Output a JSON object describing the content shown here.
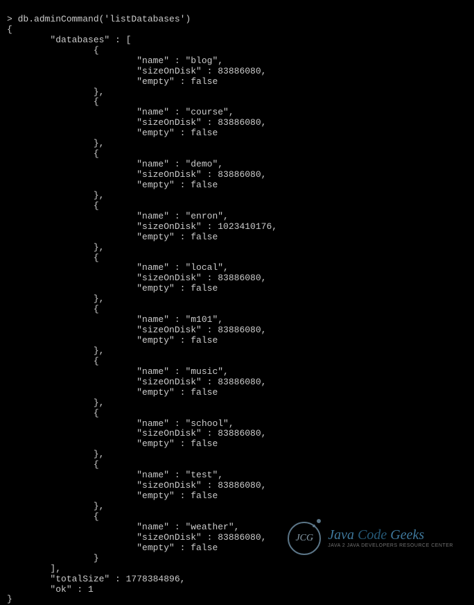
{
  "prompt": "> ",
  "command": "db.adminCommand('listDatabases')",
  "open_brace": "{",
  "databases_key": "        \"databases\" : [",
  "item_open": "                {",
  "item_close": "                },",
  "item_close_last": "                }",
  "array_close": "        ],",
  "close_brace": "}",
  "databases": [
    {
      "name": "blog",
      "sizeOnDisk": 83886080,
      "empty": false
    },
    {
      "name": "course",
      "sizeOnDisk": 83886080,
      "empty": false
    },
    {
      "name": "demo",
      "sizeOnDisk": 83886080,
      "empty": false
    },
    {
      "name": "enron",
      "sizeOnDisk": 1023410176,
      "empty": false
    },
    {
      "name": "local",
      "sizeOnDisk": 83886080,
      "empty": false
    },
    {
      "name": "m101",
      "sizeOnDisk": 83886080,
      "empty": false
    },
    {
      "name": "music",
      "sizeOnDisk": 83886080,
      "empty": false
    },
    {
      "name": "school",
      "sizeOnDisk": 83886080,
      "empty": false
    },
    {
      "name": "test",
      "sizeOnDisk": 83886080,
      "empty": false
    },
    {
      "name": "weather",
      "sizeOnDisk": 83886080,
      "empty": false
    }
  ],
  "totalSize_line": "        \"totalSize\" : 1778384896,",
  "ok_line": "        \"ok\" : 1",
  "totalSize": 1778384896,
  "ok": 1,
  "watermark": {
    "logo_text": "JCG",
    "main": "Java",
    "emph": "Code",
    "main2": "Geeks",
    "sub": "Java 2 Java Developers Resource Center"
  }
}
